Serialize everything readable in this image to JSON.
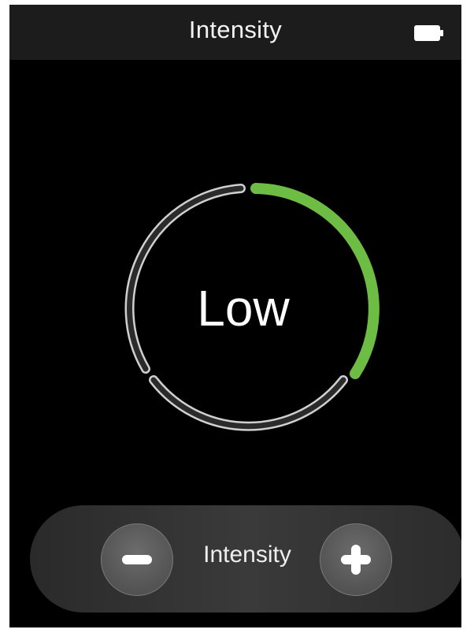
{
  "header": {
    "title": "Intensity"
  },
  "dial": {
    "level_label": "Low",
    "level_fraction": 0.33,
    "active_color": "#6dbd45",
    "inactive_color": "#d0d0d0"
  },
  "controls": {
    "label": "Intensity",
    "decrease_icon": "minus-icon",
    "increase_icon": "plus-icon"
  },
  "icons": {
    "battery": "battery-icon"
  }
}
